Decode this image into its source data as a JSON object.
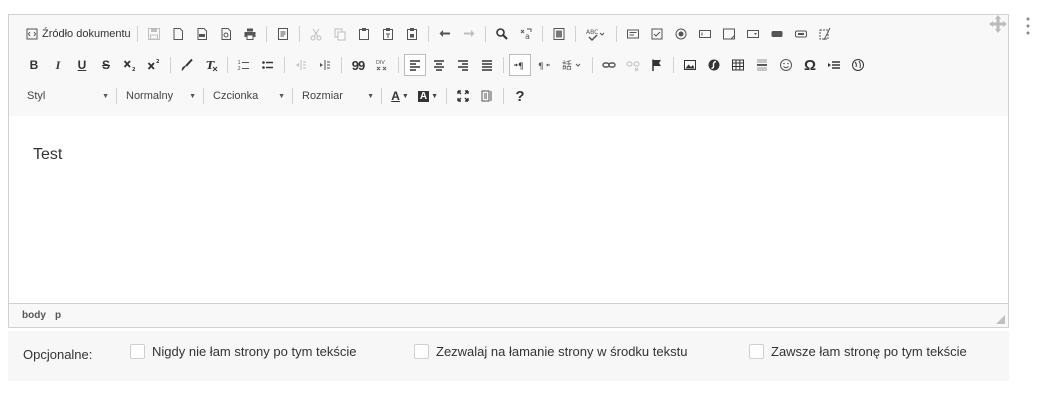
{
  "toolbar": {
    "source_label": "Źródło dokumentu",
    "style_combo": "Styl",
    "format_combo": "Normalny",
    "font_combo": "Czcionka",
    "size_combo": "Rozmiar",
    "bold_label": "B",
    "italic_label": "I",
    "underline_label": "U",
    "strike_label": "S",
    "help_label": "?",
    "text_color_label": "A",
    "bg_color_label": "A",
    "omega_label": "Ω",
    "spell_label": "ABC",
    "blockquote_label": "99"
  },
  "content": {
    "text": "Test"
  },
  "status": {
    "path": [
      "body",
      "p"
    ]
  },
  "options": {
    "label": "Opcjonalne:",
    "items": [
      "Nigdy nie łam strony po tym tekście",
      "Zezwalaj na łamanie strony w środku tekstu",
      "Zawsze łam stronę po tym tekście"
    ]
  },
  "icons": {
    "drag": "move-icon",
    "menu": "kebab-menu-icon"
  }
}
